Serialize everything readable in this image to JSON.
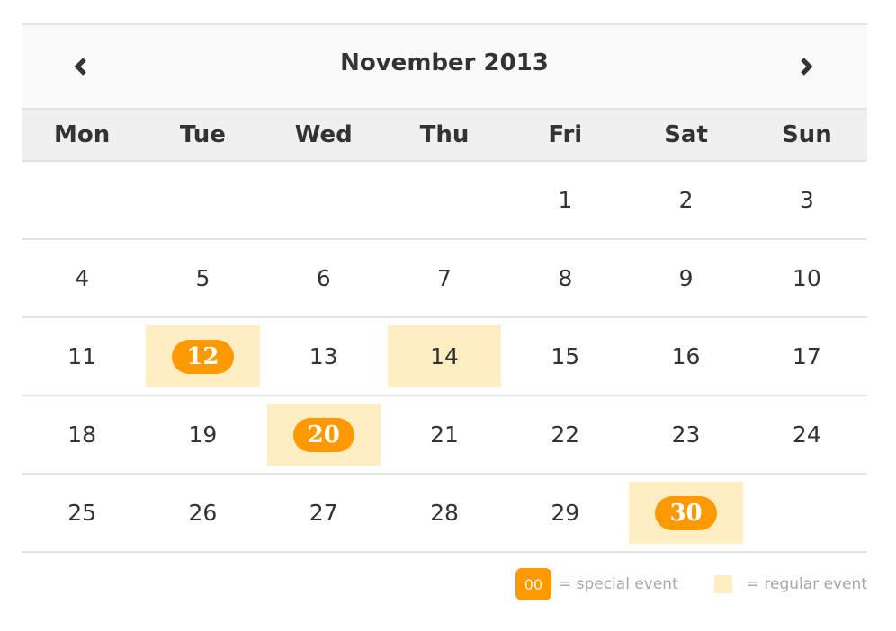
{
  "calendar": {
    "title": "November 2013",
    "prev_icon": "chevron-left-icon",
    "next_icon": "chevron-right-icon",
    "weekdays": [
      "Mon",
      "Tue",
      "Wed",
      "Thu",
      "Fri",
      "Sat",
      "Sun"
    ],
    "weeks": [
      [
        {
          "day": ""
        },
        {
          "day": ""
        },
        {
          "day": ""
        },
        {
          "day": ""
        },
        {
          "day": "1"
        },
        {
          "day": "2"
        },
        {
          "day": "3"
        }
      ],
      [
        {
          "day": "4"
        },
        {
          "day": "5"
        },
        {
          "day": "6"
        },
        {
          "day": "7"
        },
        {
          "day": "8"
        },
        {
          "day": "9"
        },
        {
          "day": "10"
        }
      ],
      [
        {
          "day": "11"
        },
        {
          "day": "12",
          "event": "special"
        },
        {
          "day": "13"
        },
        {
          "day": "14",
          "event": "regular"
        },
        {
          "day": "15"
        },
        {
          "day": "16"
        },
        {
          "day": "17"
        }
      ],
      [
        {
          "day": "18"
        },
        {
          "day": "19"
        },
        {
          "day": "20",
          "event": "special"
        },
        {
          "day": "21"
        },
        {
          "day": "22"
        },
        {
          "day": "23"
        },
        {
          "day": "24"
        }
      ],
      [
        {
          "day": "25"
        },
        {
          "day": "26"
        },
        {
          "day": "27"
        },
        {
          "day": "28"
        },
        {
          "day": "29"
        },
        {
          "day": "30",
          "event": "special"
        },
        {
          "day": ""
        }
      ]
    ]
  },
  "legend": {
    "special_swatch_label": "00",
    "special_text": "= special event",
    "regular_text": "= regular event"
  },
  "colors": {
    "special": "#ff9900",
    "regular": "#ffeec4"
  }
}
